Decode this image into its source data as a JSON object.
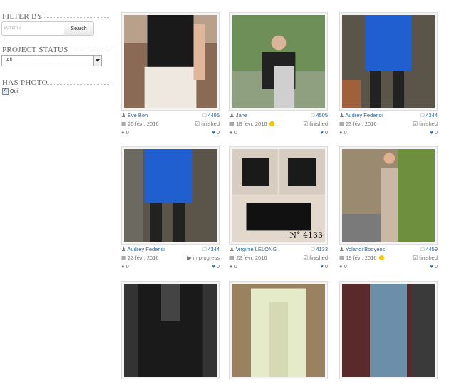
{
  "filter": {
    "filter_by_label": "FILTER BY",
    "search_placeholder": "Pattern #",
    "search_button": "Search",
    "project_status_label": "PROJECT STATUS",
    "project_status_value": "All",
    "has_photo_label": "HAS PHOTO",
    "has_photo_option": "Oui"
  },
  "cards": [
    {
      "author": "Eve Ben",
      "pattern": "4495",
      "date": "25 févr. 2016",
      "status": "finished",
      "comments": "0",
      "likes": "0",
      "smiley": false
    },
    {
      "author": "Jane",
      "pattern": "4505",
      "date": "18 févr. 2016",
      "status": "finished",
      "comments": "0",
      "likes": "0",
      "smiley": true
    },
    {
      "author": "Audrey Federici",
      "pattern": "4344",
      "date": "23 févr. 2016",
      "status": "finished",
      "comments": "0",
      "likes": "0",
      "smiley": false
    },
    {
      "author": "Audrey Federici",
      "pattern": "4344",
      "date": "23 févr. 2016",
      "status": "in progress",
      "comments": "0",
      "likes": "0",
      "smiley": false
    },
    {
      "author": "Virginie LELONG",
      "pattern": "4133",
      "date": "22 févr. 2016",
      "status": "finished",
      "comments": "0",
      "likes": "0",
      "smiley": false,
      "photo_text": "N° 4133"
    },
    {
      "author": "Yolandi Booyens",
      "pattern": "4459",
      "date": "19 févr. 2016",
      "status": "finished",
      "comments": "0",
      "likes": "0",
      "smiley": true
    },
    {
      "author": "",
      "pattern": "",
      "date": "",
      "status": "",
      "comments": "",
      "likes": "",
      "smiley": false
    },
    {
      "author": "",
      "pattern": "",
      "date": "",
      "status": "",
      "comments": "",
      "likes": "",
      "smiley": false
    },
    {
      "author": "",
      "pattern": "",
      "date": "",
      "status": "",
      "comments": "",
      "likes": "",
      "smiley": false
    }
  ],
  "colors": {
    "link": "#2a6aa8",
    "heart": "#1b5fa8",
    "smiley": "#f5c400"
  },
  "icons": {
    "author": "user-icon",
    "pattern": "file-icon",
    "date": "calendar-icon",
    "status_finished": "checkbox-icon",
    "status_progress": "play-icon",
    "comments": "comment-icon",
    "likes": "heart-icon"
  }
}
